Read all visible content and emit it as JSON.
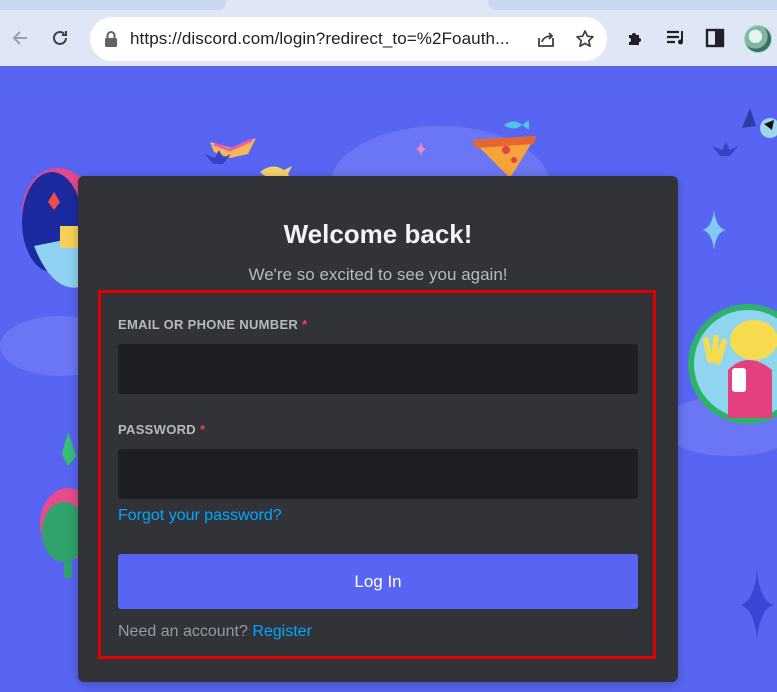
{
  "browser": {
    "url": "https://discord.com/login?redirect_to=%2Foauth...",
    "icons": [
      "back-icon",
      "reload-icon",
      "lock-icon",
      "share-icon",
      "bookmark-star-icon",
      "extensions-icon",
      "media-icon",
      "sidepanel-icon",
      "profile-avatar"
    ]
  },
  "login": {
    "title": "Welcome back!",
    "subtitle": "We're so excited to see you again!",
    "email_label": "EMAIL OR PHONE NUMBER",
    "email_value": "",
    "password_label": "PASSWORD",
    "password_value": "",
    "required_marker": "*",
    "forgot_link": "Forgot your password?",
    "login_button": "Log In",
    "need_account": "Need an account?",
    "register_link": "Register"
  },
  "colors": {
    "background": "#5865f2",
    "card": "#313338",
    "input": "#1e1f22",
    "link": "#00a8fc",
    "button": "#5865f2",
    "highlight_border": "#e00000"
  }
}
